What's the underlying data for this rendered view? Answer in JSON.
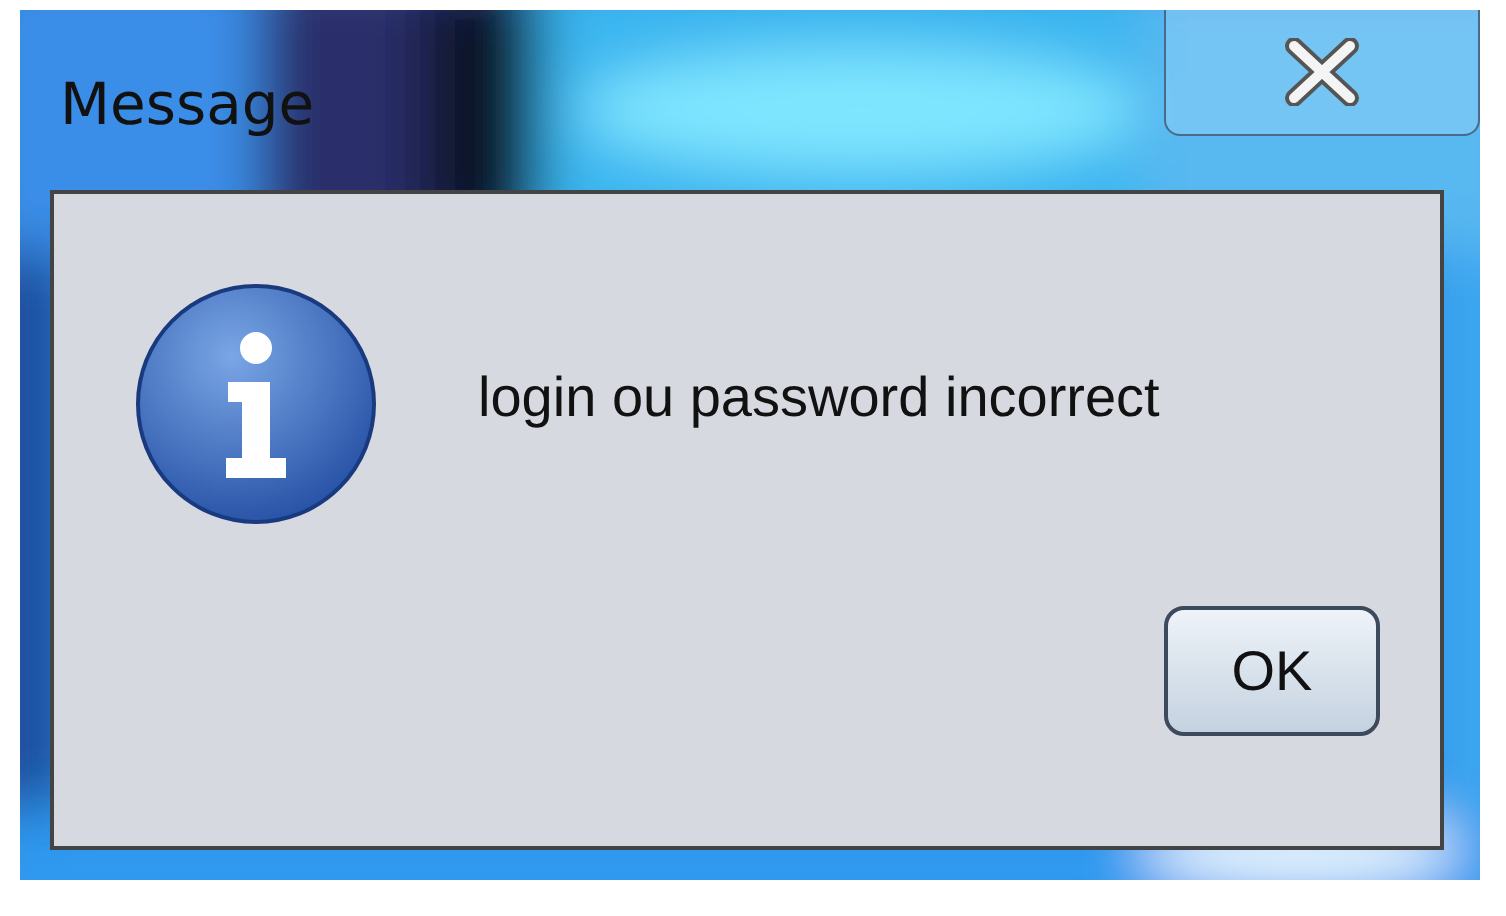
{
  "window": {
    "title": "Message"
  },
  "dialog": {
    "message": "login ou password incorrect"
  },
  "buttons": [
    "OK"
  ]
}
